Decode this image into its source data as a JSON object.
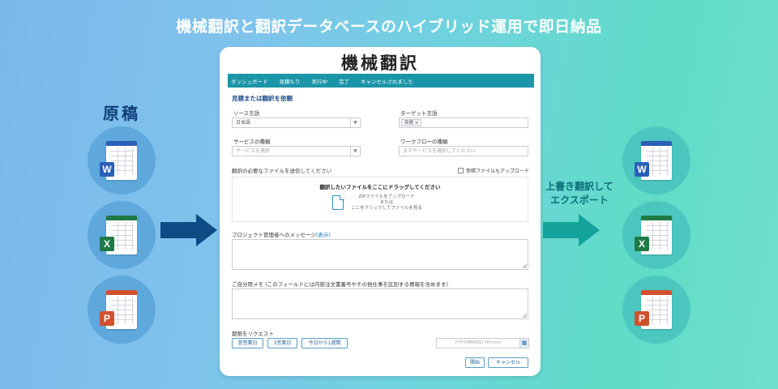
{
  "headline": "機械翻訳と翻訳データベースのハイブリッド運用で即日納品",
  "left_title": "原稿",
  "right_title": "上書き翻訳して エクスポート",
  "colors": {
    "word": "#2b5fb8",
    "excel": "#1f7a45",
    "ppt": "#d2502f",
    "nav": "#1b95a8",
    "arrow_left": "#0f4c86",
    "arrow_right": "#13a39a"
  },
  "icons": {
    "word_badge": "W",
    "excel_badge": "X",
    "ppt_badge": "P"
  },
  "panel": {
    "title": "機械翻訳",
    "nav": [
      "ダッシュボード",
      "見積もり",
      "実行中",
      "完了",
      "キャンセルされました"
    ],
    "form": {
      "section_title": "見積または翻訳を依頼",
      "source_label": "ソース言語",
      "source_value": "日本語",
      "target_label": "ターゲット言語",
      "target_chip": "英語 ×",
      "service_label": "サービスの種類",
      "service_placeholder": "サービスを選択",
      "workflow_label": "ワークフローの種類",
      "workflow_placeholder": "まずサービスを選択してください",
      "files_label": "翻訳の必要なファイルを送信してください",
      "reference_label": "参照ファイルもアップロード",
      "dropzone_title": "翻訳したいファイルをここにドラッグしてください",
      "dropzone_line1": "ZIPファイルをアップロード",
      "dropzone_line2": "または",
      "dropzone_line3": "ここをクリックしてファイルを見る",
      "message_label": "プロジェクト管理者へのメッセージ",
      "message_link": "(表示)",
      "memo_label": "ご自分用メモ (このフィールドには内部注文書番号やその他仕事を区別する情報を含めます)",
      "deadline_label": "期限をリクエスト",
      "deadline_options": [
        "翌営業日",
        "3営業日",
        "今日から1週間"
      ],
      "date_placeholder": "YYYY/MM/DD HH:mm",
      "start_button": "開始",
      "cancel_button": "キャンセル"
    }
  }
}
